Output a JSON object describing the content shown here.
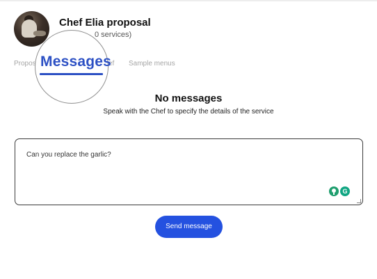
{
  "header": {
    "title": "Chef Elia proposal",
    "subtitle": "0 services)",
    "avatar_icon": "chef-photo"
  },
  "tabs": [
    {
      "label": "Propos",
      "active": false
    },
    {
      "label": "Messages",
      "active": true
    },
    {
      "label": "ef",
      "active": false
    },
    {
      "label": "Sample menus",
      "active": false
    }
  ],
  "colors": {
    "accent": "#2c50c4",
    "button": "#2451e0",
    "tab_inactive": "#a5a5a5"
  },
  "empty_state": {
    "title": "No messages",
    "subtitle": "Speak with the Chef to specify the details of the service"
  },
  "composer": {
    "value": "Can you replace the garlic?",
    "grammarly_letter": "G",
    "send_label": "Send message"
  }
}
